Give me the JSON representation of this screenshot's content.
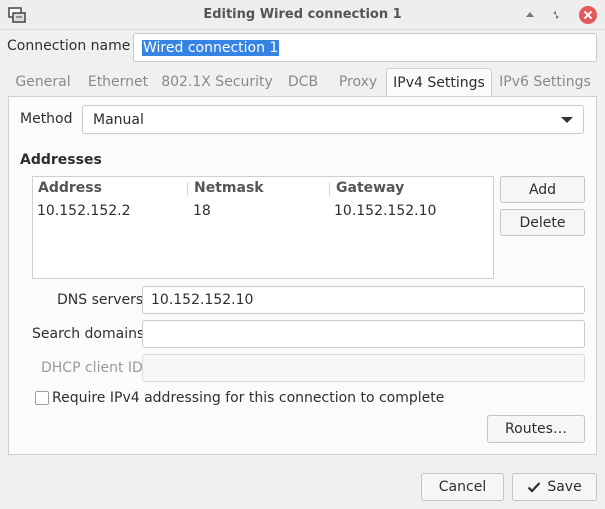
{
  "window": {
    "title": "Editing Wired connection 1"
  },
  "connection_name": {
    "label": "Connection name",
    "value": "Wired connection 1"
  },
  "tabs": [
    {
      "label": "General"
    },
    {
      "label": "Ethernet"
    },
    {
      "label": "802.1X Security"
    },
    {
      "label": "DCB"
    },
    {
      "label": "Proxy"
    },
    {
      "label": "IPv4 Settings",
      "active": true
    },
    {
      "label": "IPv6 Settings"
    }
  ],
  "ipv4": {
    "method_label": "Method",
    "method_value": "Manual",
    "addresses_title": "Addresses",
    "columns": [
      "Address",
      "Netmask",
      "Gateway"
    ],
    "rows": [
      {
        "address": "10.152.152.2",
        "netmask": "18",
        "gateway": "10.152.152.10"
      }
    ],
    "add_label": "Add",
    "delete_label": "Delete",
    "dns_label": "DNS servers",
    "dns_value": "10.152.152.10",
    "search_label": "Search domains",
    "search_value": "",
    "dhcp_label": "DHCP client ID",
    "dhcp_value": "",
    "require_label": "Require IPv4 addressing for this connection to complete",
    "require_checked": false,
    "routes_label": "Routes…"
  },
  "footer": {
    "cancel_label": "Cancel",
    "save_label": "Save"
  },
  "colors": {
    "selection": "#3584e4",
    "close_button": "#e45a5a"
  }
}
